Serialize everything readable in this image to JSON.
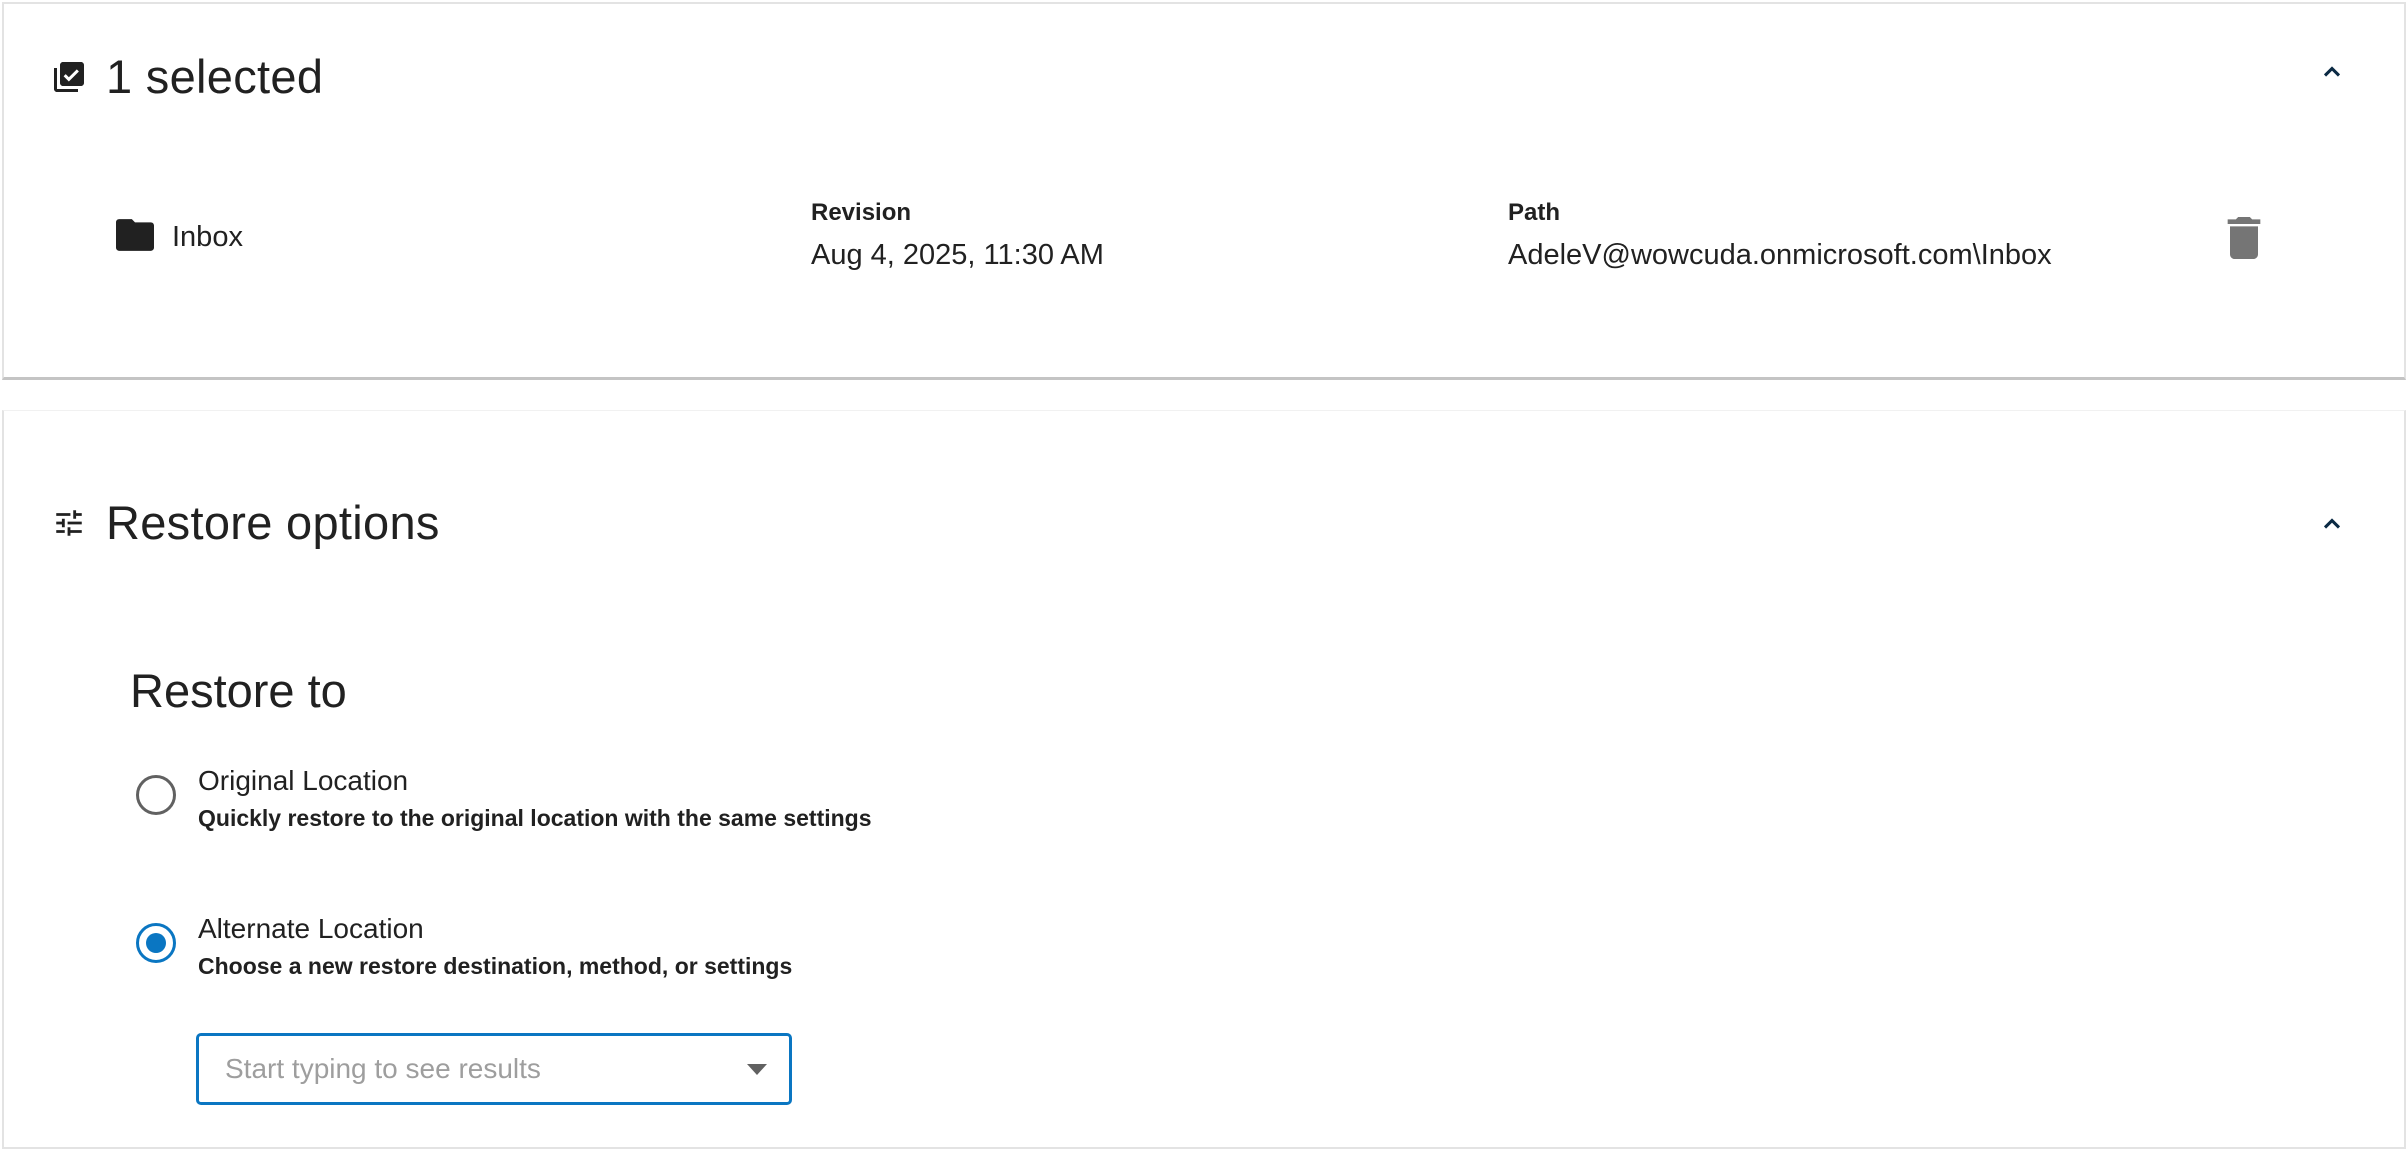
{
  "selected_panel": {
    "icon": "checklist-icon",
    "title": "1 selected",
    "collapse_icon": "chevron-up-icon",
    "item": {
      "icon": "folder-icon",
      "name": "Inbox",
      "revision_label": "Revision",
      "revision_value": "Aug 4, 2025, 11:30 AM",
      "path_label": "Path",
      "path_value": "AdeleV@wowcuda.onmicrosoft.com\\Inbox",
      "delete_icon": "trash-icon"
    }
  },
  "restore_panel": {
    "icon": "tune-sliders-icon",
    "title": "Restore options",
    "collapse_icon": "chevron-up-icon",
    "restore_to_heading": "Restore to",
    "options": [
      {
        "title": "Original Location",
        "description": "Quickly restore to the original location with the same settings",
        "selected": false
      },
      {
        "title": "Alternate Location",
        "description": "Choose a new restore destination, method, or settings",
        "selected": true
      }
    ],
    "destination": {
      "value": "",
      "placeholder": "Start typing to see results"
    }
  },
  "colors": {
    "accent": "#0a76c2",
    "text": "#212121",
    "icon_gray": "#757575",
    "border": "#e3e3e3"
  }
}
